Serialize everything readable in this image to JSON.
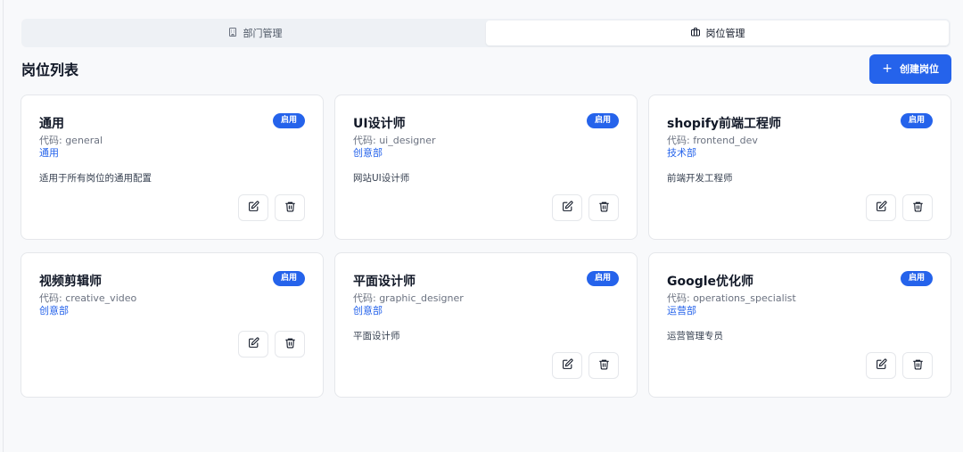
{
  "tabs": [
    {
      "label": "部门管理",
      "icon": "building-icon",
      "active": false
    },
    {
      "label": "岗位管理",
      "icon": "briefcase-icon",
      "active": true
    }
  ],
  "header": {
    "title": "岗位列表",
    "create_label": "创建岗位"
  },
  "positions": [
    {
      "name": "通用",
      "code": "代码: general",
      "department": "通用",
      "status": "启用",
      "description": "适用于所有岗位的通用配置"
    },
    {
      "name": "UI设计师",
      "code": "代码: ui_designer",
      "department": "创意部",
      "status": "启用",
      "description": "网站UI设计师"
    },
    {
      "name": "shopify前端工程师",
      "code": "代码: frontend_dev",
      "department": "技术部",
      "status": "启用",
      "description": "前端开发工程师"
    },
    {
      "name": "视频剪辑师",
      "code": "代码: creative_video",
      "department": "创意部",
      "status": "启用",
      "description": ""
    },
    {
      "name": "平面设计师",
      "code": "代码: graphic_designer",
      "department": "创意部",
      "status": "启用",
      "description": "平面设计师"
    },
    {
      "name": "Google优化师",
      "code": "代码: operations_specialist",
      "department": "运营部",
      "status": "启用",
      "description": "运营管理专员"
    }
  ],
  "colors": {
    "accent": "#2563eb",
    "background": "#f8f9fb"
  }
}
